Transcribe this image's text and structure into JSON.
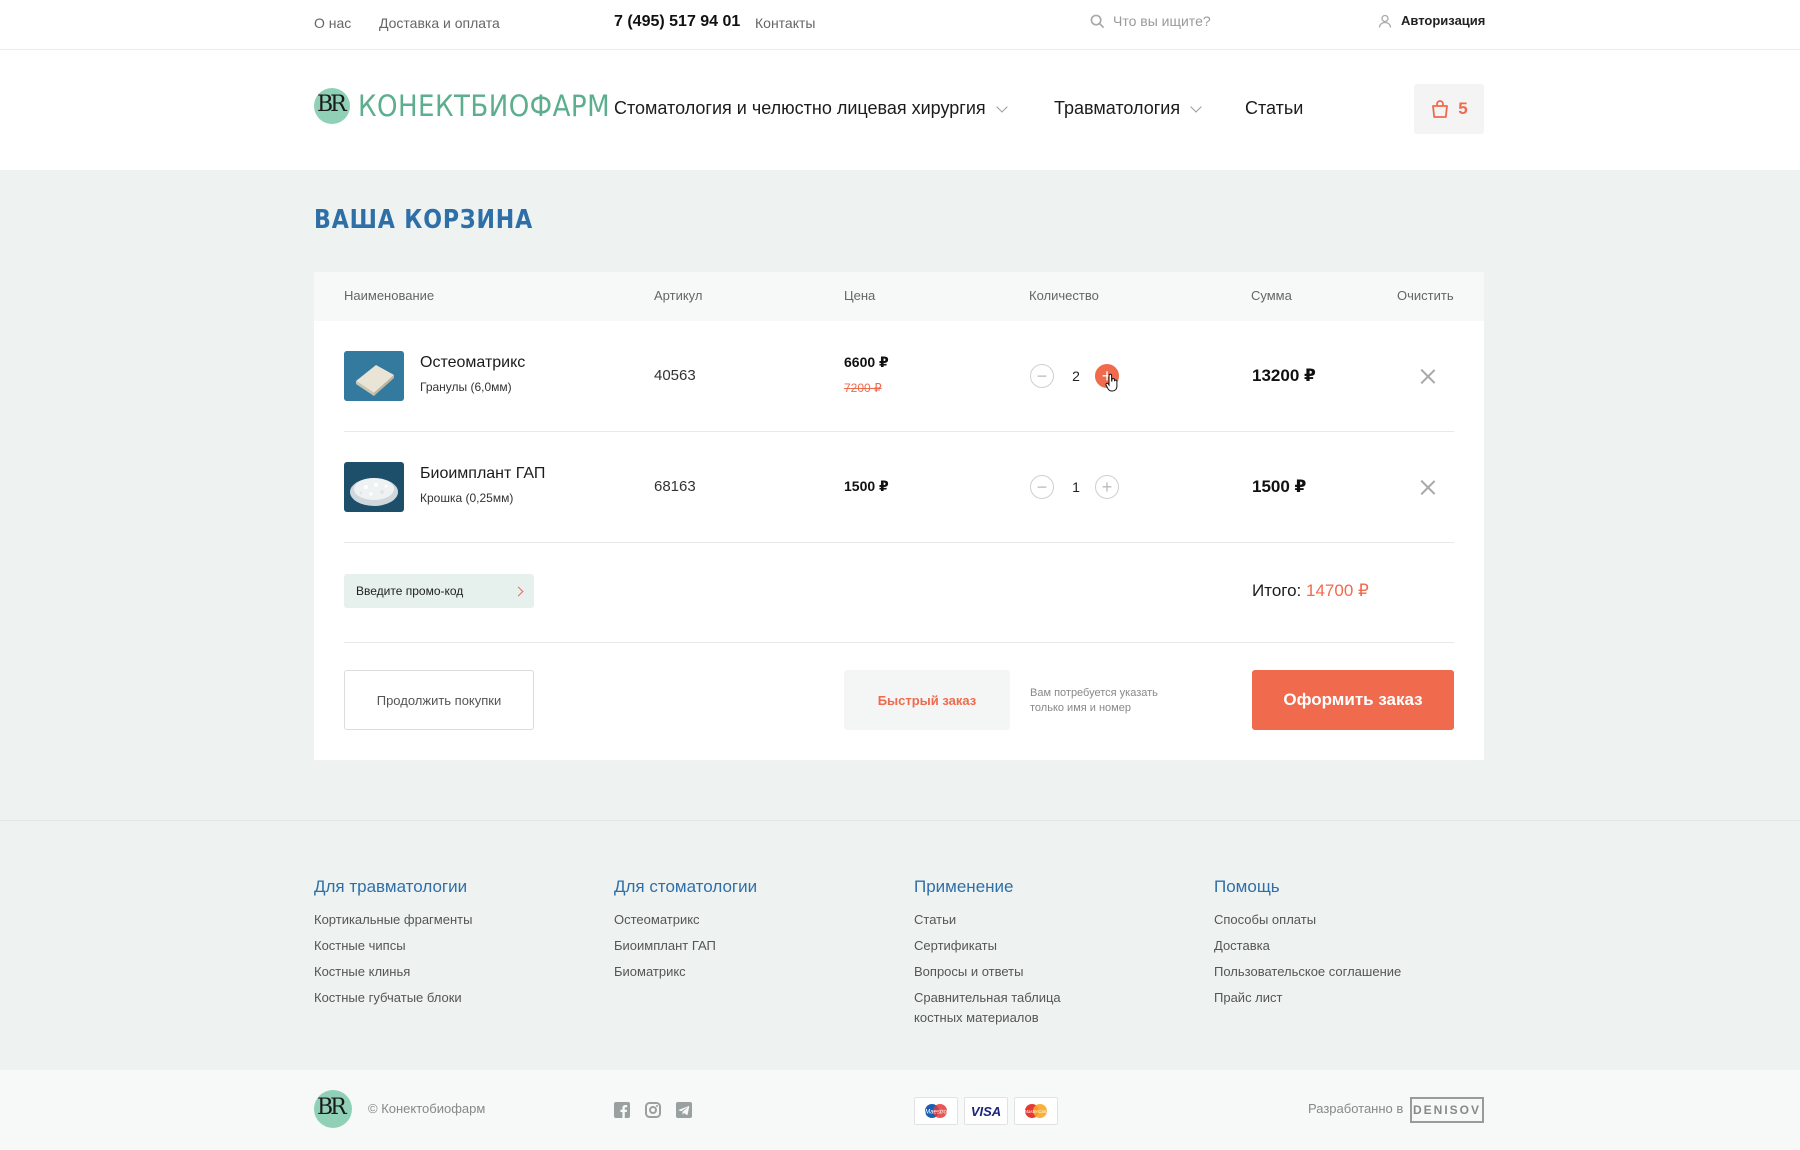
{
  "topbar": {
    "links": [
      "О нас",
      "Доставка и оплата"
    ],
    "phone": "7 (495) 517 94 01",
    "contacts": "Контакты",
    "search_placeholder": "Что вы ищите?",
    "auth": "Авторизация"
  },
  "header": {
    "logo_mark": "BR",
    "logo_text": "Конектбиофарм",
    "nav": [
      {
        "label": "Стоматология и челюстно лицевая хирургия"
      },
      {
        "label": "Травматология"
      },
      {
        "label": "Статьи"
      }
    ],
    "cart_count": "5"
  },
  "cart": {
    "title": "Ваша корзина",
    "columns": [
      "Наименование",
      "Артикул",
      "Цена",
      "Количество",
      "Сумма",
      "Очистить"
    ],
    "items": [
      {
        "name": "Остеоматрикс",
        "variant": "Гранулы (6,0мм)",
        "sku": "40563",
        "price": "6600 ₽",
        "old_price": "7200 ₽",
        "qty": "2",
        "sum": "13200 ₽"
      },
      {
        "name": "Биоимплант ГАП",
        "variant": "Крошка (0,25мм)",
        "sku": "68163",
        "price": "1500 ₽",
        "qty": "1",
        "sum": "1500 ₽"
      }
    ],
    "promo_label": "Введите промо-код",
    "total_label": "Итого:",
    "total_value": "14700 ₽",
    "continue_label": "Продолжить покупки",
    "quick_label": "Быстрый заказ",
    "quick_note": "Вам потребуется указать только имя и номер",
    "order_label": "Оформить заказ"
  },
  "footer": {
    "columns": [
      {
        "title": "Для травматологии",
        "links": [
          "Кортикальные фрагменты",
          "Костные чипсы",
          "Костные клинья",
          "Костные губчатые блоки"
        ]
      },
      {
        "title": "Для стоматологии",
        "links": [
          "Остеоматрикс",
          "Биоимплант ГАП",
          "Биоматрикс"
        ]
      },
      {
        "title": "Применение",
        "links": [
          "Статьи",
          "Сертификаты",
          "Вопросы и ответы",
          "Сравнительная таблица костных материалов"
        ]
      },
      {
        "title": "Помощь",
        "links": [
          "Способы оплаты",
          "Доставка",
          "Пользовательское соглашение",
          "Прайс лист"
        ]
      }
    ],
    "copyright": "© Конектобиофарм",
    "payments": [
      "Maestro",
      "VISA",
      "MasterCard"
    ],
    "developed_by": "Разработанно в",
    "developer": "DENISOV"
  },
  "colors": {
    "accent": "#f06a4d",
    "brand_green": "#5cae8f",
    "title_blue": "#2f6fa8",
    "bg": "#eef3f2"
  },
  "icons": [
    "search-icon",
    "user-icon",
    "cart-icon",
    "chevron-down-icon",
    "minus-icon",
    "plus-icon",
    "close-icon",
    "chevron-right-icon",
    "facebook-icon",
    "instagram-icon",
    "telegram-icon"
  ]
}
